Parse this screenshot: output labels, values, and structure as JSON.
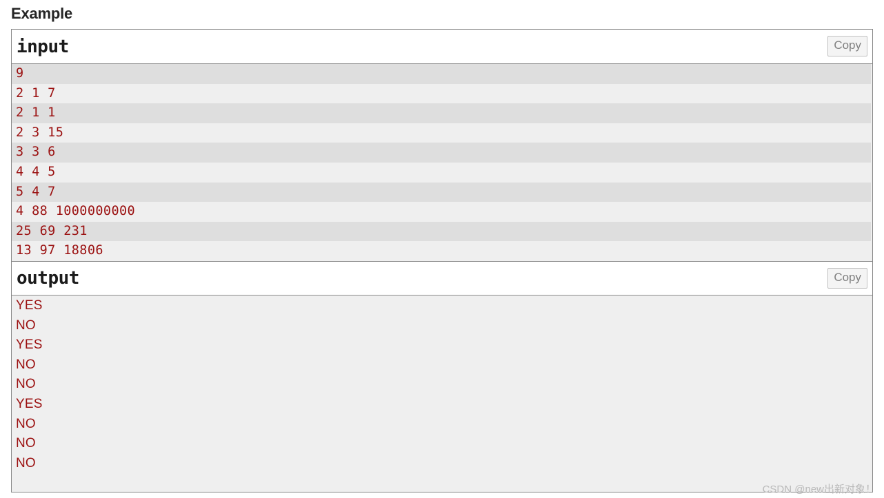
{
  "page": {
    "heading": "Example",
    "watermark": "CSDN @new出新对象！"
  },
  "input_section": {
    "title": "input",
    "copy_label": "Copy",
    "lines": [
      "9",
      "2 1 7",
      "2 1 1",
      "2 3 15",
      "3 3 6",
      "4 4 5",
      "5 4 7",
      "4 88 1000000000",
      "25 69 231",
      "13 97 18806"
    ]
  },
  "output_section": {
    "title": "output",
    "copy_label": "Copy",
    "lines": [
      "YES",
      "NO",
      "YES",
      "NO",
      "NO",
      "YES",
      "NO",
      "NO",
      "NO"
    ]
  },
  "colors": {
    "code_text": "#9b1111",
    "border": "#888888",
    "stripe_dark": "#dedede",
    "stripe_light": "#efefef",
    "copy_text": "#808080",
    "watermark": "#b9b9b9"
  }
}
